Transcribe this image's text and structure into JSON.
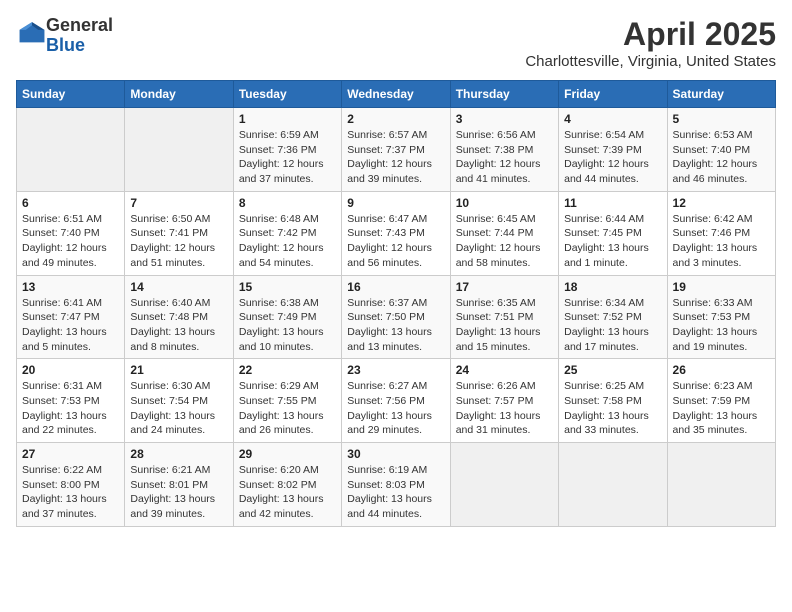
{
  "header": {
    "logo_general": "General",
    "logo_blue": "Blue",
    "title": "April 2025",
    "subtitle": "Charlottesville, Virginia, United States"
  },
  "calendar": {
    "days_of_week": [
      "Sunday",
      "Monday",
      "Tuesday",
      "Wednesday",
      "Thursday",
      "Friday",
      "Saturday"
    ],
    "weeks": [
      [
        {
          "num": "",
          "info": ""
        },
        {
          "num": "",
          "info": ""
        },
        {
          "num": "1",
          "info": "Sunrise: 6:59 AM\nSunset: 7:36 PM\nDaylight: 12 hours and 37 minutes."
        },
        {
          "num": "2",
          "info": "Sunrise: 6:57 AM\nSunset: 7:37 PM\nDaylight: 12 hours and 39 minutes."
        },
        {
          "num": "3",
          "info": "Sunrise: 6:56 AM\nSunset: 7:38 PM\nDaylight: 12 hours and 41 minutes."
        },
        {
          "num": "4",
          "info": "Sunrise: 6:54 AM\nSunset: 7:39 PM\nDaylight: 12 hours and 44 minutes."
        },
        {
          "num": "5",
          "info": "Sunrise: 6:53 AM\nSunset: 7:40 PM\nDaylight: 12 hours and 46 minutes."
        }
      ],
      [
        {
          "num": "6",
          "info": "Sunrise: 6:51 AM\nSunset: 7:40 PM\nDaylight: 12 hours and 49 minutes."
        },
        {
          "num": "7",
          "info": "Sunrise: 6:50 AM\nSunset: 7:41 PM\nDaylight: 12 hours and 51 minutes."
        },
        {
          "num": "8",
          "info": "Sunrise: 6:48 AM\nSunset: 7:42 PM\nDaylight: 12 hours and 54 minutes."
        },
        {
          "num": "9",
          "info": "Sunrise: 6:47 AM\nSunset: 7:43 PM\nDaylight: 12 hours and 56 minutes."
        },
        {
          "num": "10",
          "info": "Sunrise: 6:45 AM\nSunset: 7:44 PM\nDaylight: 12 hours and 58 minutes."
        },
        {
          "num": "11",
          "info": "Sunrise: 6:44 AM\nSunset: 7:45 PM\nDaylight: 13 hours and 1 minute."
        },
        {
          "num": "12",
          "info": "Sunrise: 6:42 AM\nSunset: 7:46 PM\nDaylight: 13 hours and 3 minutes."
        }
      ],
      [
        {
          "num": "13",
          "info": "Sunrise: 6:41 AM\nSunset: 7:47 PM\nDaylight: 13 hours and 5 minutes."
        },
        {
          "num": "14",
          "info": "Sunrise: 6:40 AM\nSunset: 7:48 PM\nDaylight: 13 hours and 8 minutes."
        },
        {
          "num": "15",
          "info": "Sunrise: 6:38 AM\nSunset: 7:49 PM\nDaylight: 13 hours and 10 minutes."
        },
        {
          "num": "16",
          "info": "Sunrise: 6:37 AM\nSunset: 7:50 PM\nDaylight: 13 hours and 13 minutes."
        },
        {
          "num": "17",
          "info": "Sunrise: 6:35 AM\nSunset: 7:51 PM\nDaylight: 13 hours and 15 minutes."
        },
        {
          "num": "18",
          "info": "Sunrise: 6:34 AM\nSunset: 7:52 PM\nDaylight: 13 hours and 17 minutes."
        },
        {
          "num": "19",
          "info": "Sunrise: 6:33 AM\nSunset: 7:53 PM\nDaylight: 13 hours and 19 minutes."
        }
      ],
      [
        {
          "num": "20",
          "info": "Sunrise: 6:31 AM\nSunset: 7:53 PM\nDaylight: 13 hours and 22 minutes."
        },
        {
          "num": "21",
          "info": "Sunrise: 6:30 AM\nSunset: 7:54 PM\nDaylight: 13 hours and 24 minutes."
        },
        {
          "num": "22",
          "info": "Sunrise: 6:29 AM\nSunset: 7:55 PM\nDaylight: 13 hours and 26 minutes."
        },
        {
          "num": "23",
          "info": "Sunrise: 6:27 AM\nSunset: 7:56 PM\nDaylight: 13 hours and 29 minutes."
        },
        {
          "num": "24",
          "info": "Sunrise: 6:26 AM\nSunset: 7:57 PM\nDaylight: 13 hours and 31 minutes."
        },
        {
          "num": "25",
          "info": "Sunrise: 6:25 AM\nSunset: 7:58 PM\nDaylight: 13 hours and 33 minutes."
        },
        {
          "num": "26",
          "info": "Sunrise: 6:23 AM\nSunset: 7:59 PM\nDaylight: 13 hours and 35 minutes."
        }
      ],
      [
        {
          "num": "27",
          "info": "Sunrise: 6:22 AM\nSunset: 8:00 PM\nDaylight: 13 hours and 37 minutes."
        },
        {
          "num": "28",
          "info": "Sunrise: 6:21 AM\nSunset: 8:01 PM\nDaylight: 13 hours and 39 minutes."
        },
        {
          "num": "29",
          "info": "Sunrise: 6:20 AM\nSunset: 8:02 PM\nDaylight: 13 hours and 42 minutes."
        },
        {
          "num": "30",
          "info": "Sunrise: 6:19 AM\nSunset: 8:03 PM\nDaylight: 13 hours and 44 minutes."
        },
        {
          "num": "",
          "info": ""
        },
        {
          "num": "",
          "info": ""
        },
        {
          "num": "",
          "info": ""
        }
      ]
    ]
  }
}
